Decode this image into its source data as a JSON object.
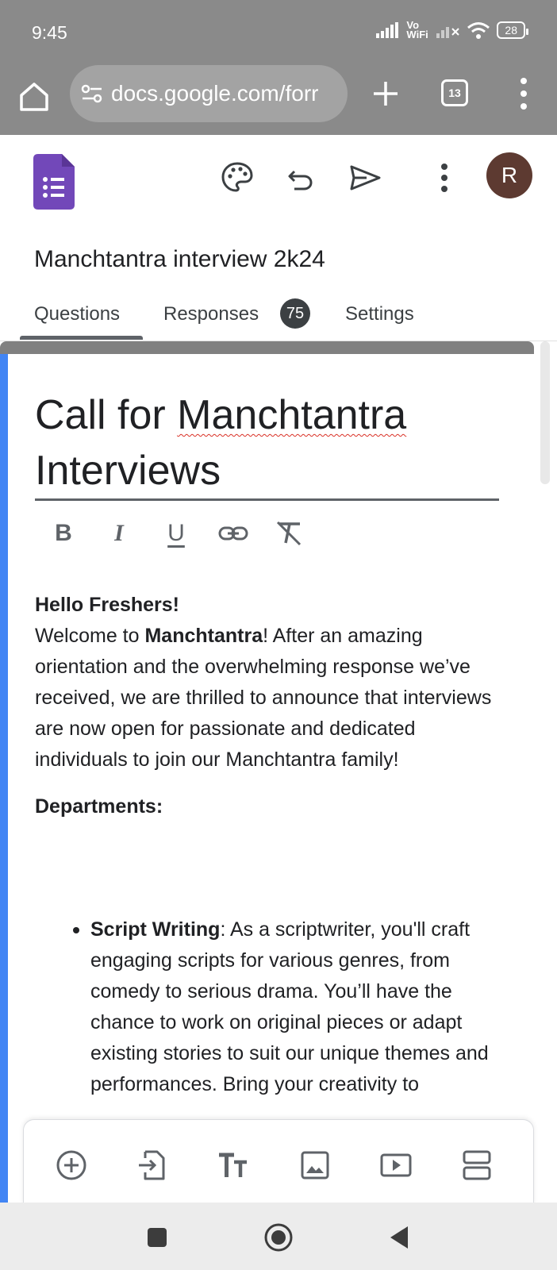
{
  "status_bar": {
    "time": "9:45",
    "network_label": "Vo WiFi",
    "battery": "28"
  },
  "browser": {
    "url": "docs.google.com/forr",
    "tab_count": "13"
  },
  "forms_header": {
    "avatar_letter": "R",
    "avatar_color": "#5d3a31",
    "form_title": "Manchtantra interview 2k24",
    "tabs": [
      {
        "label": "Questions"
      },
      {
        "label": "Responses"
      },
      {
        "label": "Settings"
      }
    ],
    "responses_count": "75"
  },
  "card": {
    "title_line1_word1": "Call for",
    "title_line1_word2": "Manchtantra",
    "title_line2": "Interviews",
    "format_buttons": {
      "bold": "B",
      "italic": "I",
      "underline": "U"
    },
    "greeting": "Hello Freshers!",
    "welcome_prefix": "Welcome to",
    "welcome_brand": "Manchtantra",
    "welcome_rest": "! After an amazing orientation and the overwhelming response we’ve received, we are thrilled to announce that interviews are now open for passionate and dedicated individuals to join our Manchtantra family!",
    "departments_heading": "Departments:",
    "departments": [
      {
        "name": "Script Writing",
        "description": ": As a scriptwriter, you'll craft engaging scripts for various genres, from comedy to serious drama. You’ll have the chance to work on original pieces or adapt existing stories to suit our unique themes and performances. Bring your creativity to"
      }
    ]
  },
  "colors": {
    "accent_blue": "#4285f4",
    "forms_purple": "#7248b9",
    "chrome_gray": "#8a8a8a"
  }
}
